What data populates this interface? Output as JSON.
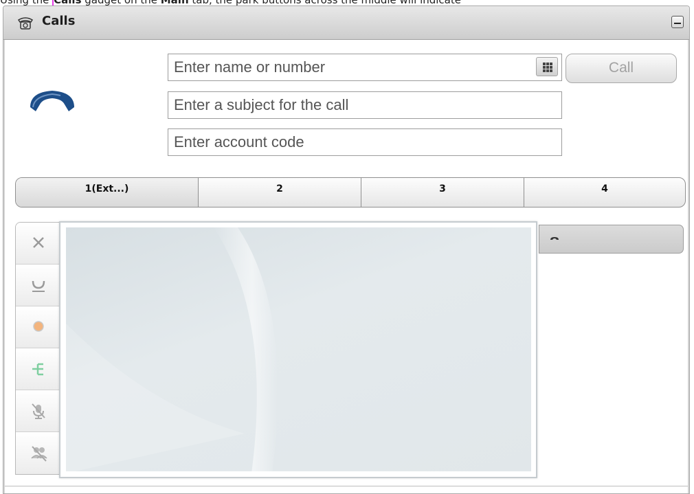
{
  "intro": {
    "lead": "Using the ",
    "highlight": "   ",
    "rest_bold": " Calls",
    "rest": " gadget on the ",
    "tab_bold": "Main",
    "tail": " tab, the park buttons across the middle will indicate"
  },
  "gadget": {
    "title": "Calls",
    "name_placeholder": "Enter name or number",
    "subject_placeholder": "Enter a subject for the call",
    "account_placeholder": "Enter account code",
    "call_label": "Call",
    "tabs": [
      {
        "label": "1(Ext...)",
        "active": true
      },
      {
        "label": "2",
        "active": false
      },
      {
        "label": "3",
        "active": false
      },
      {
        "label": "4",
        "active": false
      }
    ],
    "controls": [
      "drop-call",
      "park-call",
      "hold",
      "transfer",
      "mute",
      "conference"
    ]
  },
  "colors": {
    "handset": "#1d4e89",
    "hold_dot": "#f3b47d",
    "transfer": "#7fcfa0",
    "highlight": "#e53be5"
  }
}
